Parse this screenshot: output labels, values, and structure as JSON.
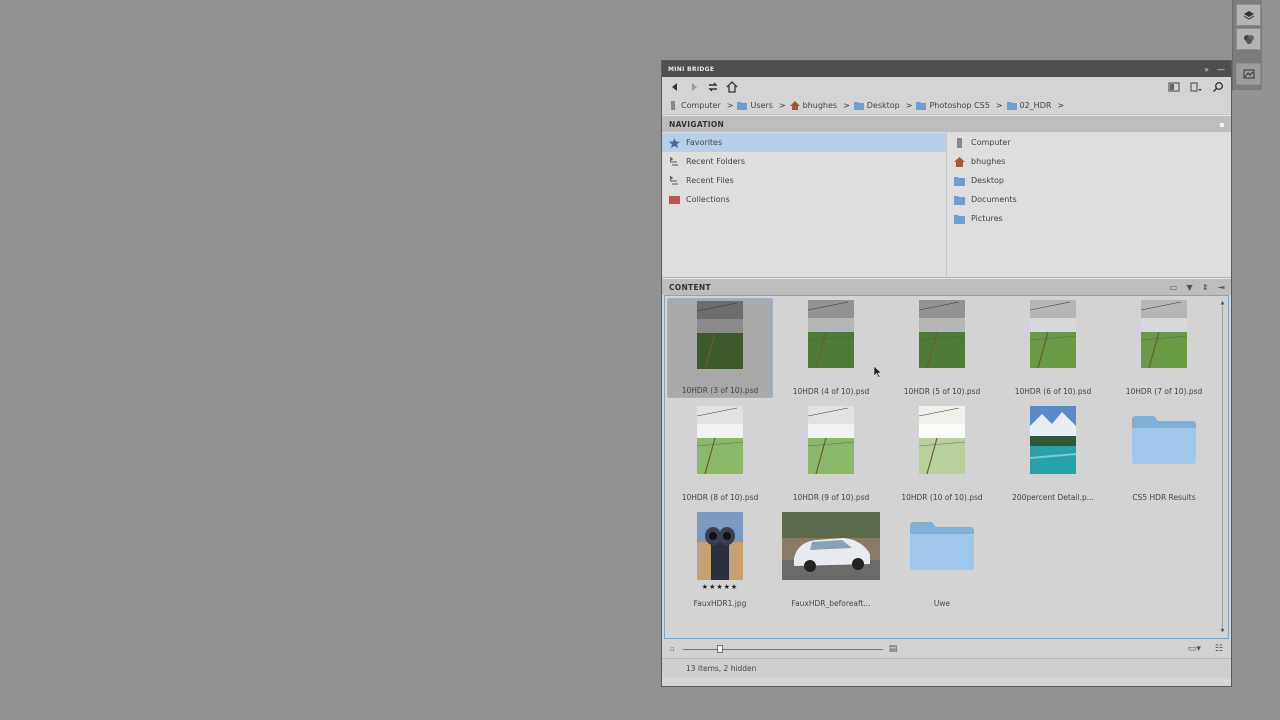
{
  "panel": {
    "title": "MINI BRIDGE",
    "toolbar": {
      "back_icon": "back-arrow-icon",
      "forward_icon": "forward-arrow-icon",
      "refresh_icon": "sync-icon",
      "home_icon": "home-icon"
    },
    "breadcrumb": [
      "Computer",
      "Users",
      "bhughes",
      "Desktop",
      "Photoshop CS5",
      "02_HDR"
    ]
  },
  "navigation": {
    "heading": "NAVIGATION",
    "left_items": [
      {
        "label": "Favorites",
        "icon": "star-icon",
        "selected": true
      },
      {
        "label": "Recent Folders",
        "icon": "recent-icon",
        "selected": false
      },
      {
        "label": "Recent Files",
        "icon": "recent-icon",
        "selected": false
      },
      {
        "label": "Collections",
        "icon": "collection-icon",
        "selected": false
      }
    ],
    "right_items": [
      {
        "label": "Computer",
        "icon": "computer-icon"
      },
      {
        "label": "bhughes",
        "icon": "home-icon"
      },
      {
        "label": "Desktop",
        "icon": "folder-icon"
      },
      {
        "label": "Documents",
        "icon": "folder-icon"
      },
      {
        "label": "Pictures",
        "icon": "folder-icon"
      }
    ]
  },
  "content": {
    "heading": "CONTENT",
    "items": [
      {
        "label": "10HDR (3 of 10).psd",
        "kind": "photo",
        "tone": "dark",
        "selected": true,
        "rating": "· · · · ·"
      },
      {
        "label": "10HDR (4 of 10).psd",
        "kind": "photo",
        "tone": "mid"
      },
      {
        "label": "10HDR (5 of 10).psd",
        "kind": "photo",
        "tone": "mid"
      },
      {
        "label": "10HDR (6 of 10).psd",
        "kind": "photo",
        "tone": "light"
      },
      {
        "label": "10HDR (7 of 10).psd",
        "kind": "photo",
        "tone": "light"
      },
      {
        "label": "10HDR (8 of 10).psd",
        "kind": "photo",
        "tone": "bright"
      },
      {
        "label": "10HDR (9 of 10).psd",
        "kind": "photo",
        "tone": "bright"
      },
      {
        "label": "10HDR (10 of 10).psd",
        "kind": "photo",
        "tone": "washed"
      },
      {
        "label": "200percent Detail.p...",
        "kind": "lake"
      },
      {
        "label": "CS5 HDR Results",
        "kind": "folder"
      },
      {
        "label": "FauxHDR1.jpg",
        "kind": "binocular",
        "stars": "★★★★★"
      },
      {
        "label": "FauxHDR_beforeaft...",
        "kind": "car"
      },
      {
        "label": "Uwe",
        "kind": "folder"
      }
    ]
  },
  "status": "13 items, 2 hidden"
}
